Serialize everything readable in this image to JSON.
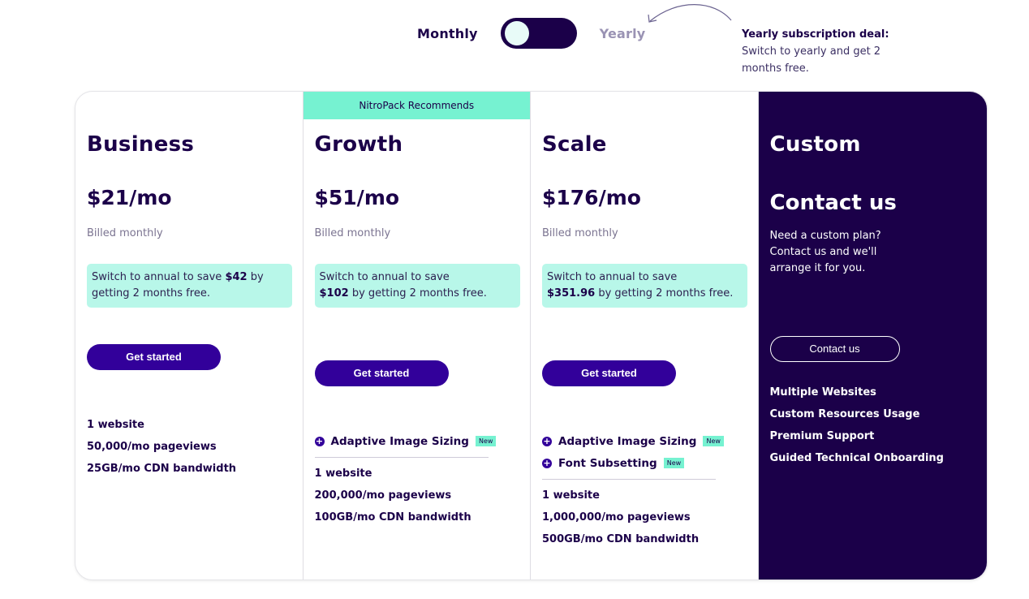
{
  "toggle": {
    "monthly_label": "Monthly",
    "yearly_label": "Yearly",
    "selected": "Monthly"
  },
  "deal": {
    "title": "Yearly subscription deal:",
    "text": "Switch to yearly and get 2 months free."
  },
  "colors": {
    "brand_dark": "#1b0049",
    "button": "#32009a",
    "mint": "#76f2d1",
    "mint_light": "#b8f7e9"
  },
  "plans": [
    {
      "name": "Business",
      "price": "$21/mo",
      "billed": "Billed monthly",
      "save_prefix": "Switch to annual to save ",
      "save_amount": "$42",
      "save_suffix": " by getting 2 months free.",
      "cta": "Get started",
      "features": [
        "1 website",
        "50,000/mo pageviews",
        "25GB/mo CDN bandwidth"
      ]
    },
    {
      "banner": "NitroPack Recommends",
      "name": "Growth",
      "price": "$51/mo",
      "billed": "Billed monthly",
      "save_prefix": "Switch to annual to save ",
      "save_amount": "$102",
      "save_suffix": " by getting 2 months free.",
      "cta": "Get started",
      "addons": [
        {
          "label": "Adaptive Image Sizing",
          "badge": "New",
          "icon": "plus-circle-icon"
        }
      ],
      "features": [
        "1 website",
        "200,000/mo pageviews",
        "100GB/mo CDN bandwidth"
      ]
    },
    {
      "name": "Scale",
      "price": "$176/mo",
      "billed": "Billed monthly",
      "save_prefix": "Switch to annual to save ",
      "save_amount": "$351.96",
      "save_suffix": " by getting 2 months free.",
      "cta": "Get started",
      "addons": [
        {
          "label": "Adaptive Image Sizing",
          "badge": "New",
          "icon": "plus-circle-icon"
        },
        {
          "label": "Font Subsetting",
          "badge": "New",
          "icon": "plus-circle-icon"
        }
      ],
      "features": [
        "1 website",
        "1,000,000/mo pageviews",
        "500GB/mo CDN bandwidth"
      ]
    },
    {
      "name": "Custom",
      "contact_title": "Contact us",
      "contact_text": "Need a custom plan? Contact us and we'll arrange it for you.",
      "cta": "Contact us",
      "features": [
        "Multiple Websites",
        "Custom Resources Usage",
        "Premium Support",
        "Guided Technical Onboarding"
      ]
    }
  ]
}
